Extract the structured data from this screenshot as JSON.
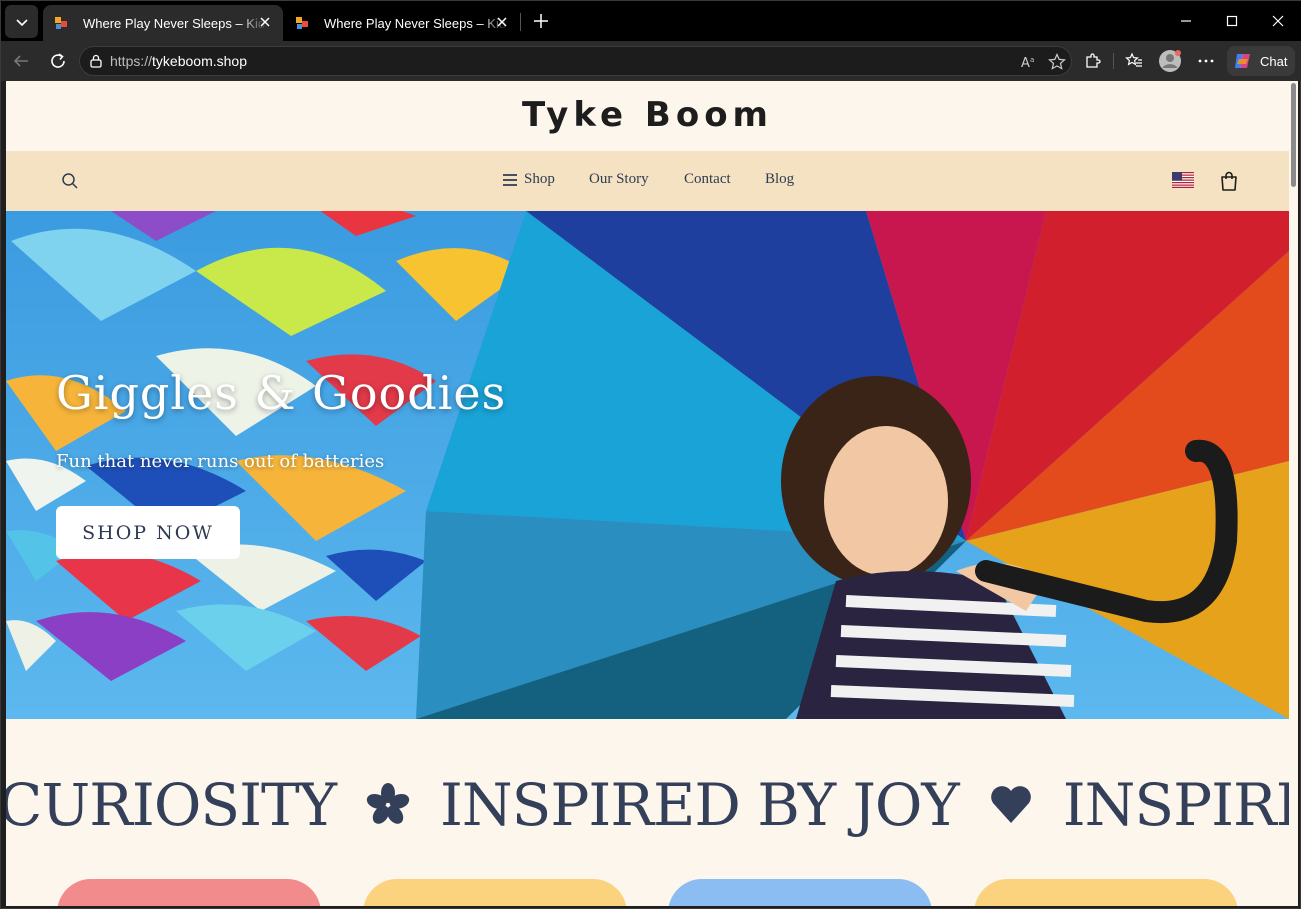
{
  "browser": {
    "tabs": [
      {
        "title": "Where Play Never Sleeps – Kids' Toys",
        "active": true
      },
      {
        "title": "Where Play Never Sleeps – Kids' Toys",
        "active": false
      }
    ],
    "url_protocol": "https://",
    "url_host": "tykeboom.shop",
    "chat_label": "Chat"
  },
  "site": {
    "logo": "Tyke Boom",
    "nav": {
      "shop": "Shop",
      "our_story": "Our Story",
      "contact": "Contact",
      "blog": "Blog"
    },
    "hero": {
      "title": "Giggles & Goodies",
      "subtitle": "Fun that never runs out of batteries",
      "cta": "SHOP NOW"
    },
    "marquee": {
      "items": [
        "CURIOSITY",
        "INSPIRED BY JOY",
        "INSPIRE"
      ]
    },
    "card_colors": [
      "#f28b8b",
      "#fbd27e",
      "#8bbdf2",
      "#fbd27e"
    ]
  },
  "colors": {
    "page_bg": "#fdf6ec",
    "nav_bg": "#f5e2c2",
    "text_dark": "#2f3b52"
  }
}
